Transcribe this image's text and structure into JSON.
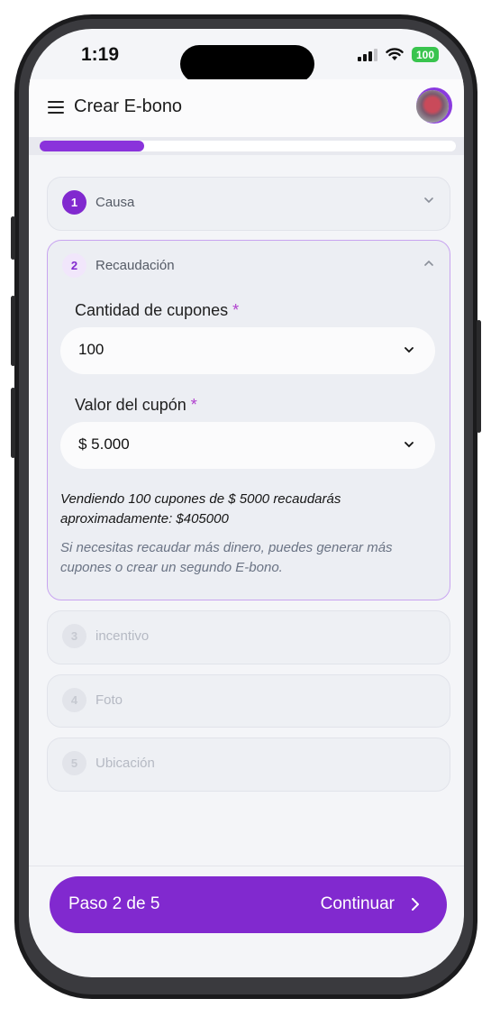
{
  "status_bar": {
    "time": "1:19",
    "battery": "100"
  },
  "header": {
    "title": "Crear E-bono"
  },
  "progress": {
    "fraction": 0.25
  },
  "steps": [
    {
      "number": "1",
      "label": "Causa"
    },
    {
      "number": "2",
      "label": "Recaudación"
    },
    {
      "number": "3",
      "label": "incentivo"
    },
    {
      "number": "4",
      "label": "Foto"
    },
    {
      "number": "5",
      "label": "Ubicación"
    }
  ],
  "form": {
    "coupons_label": "Cantidad de cupones",
    "coupons_value": "100",
    "coupon_value_label": "Valor del cupón",
    "coupon_value": "$ 5.000",
    "required_mark": "*",
    "summary": "Vendiendo 100 cupones de $ 5000 recaudarás aproximadamente: $405000",
    "hint": "Si necesitas recaudar más dinero, puedes generar más cupones o crear un segundo E-bono."
  },
  "footer": {
    "step_text": "Paso 2 de 5",
    "continue_label": "Continuar"
  },
  "colors": {
    "accent": "#8129cf",
    "progress": "#8a33db",
    "required": "#b03fce",
    "battery": "#39c44e"
  }
}
